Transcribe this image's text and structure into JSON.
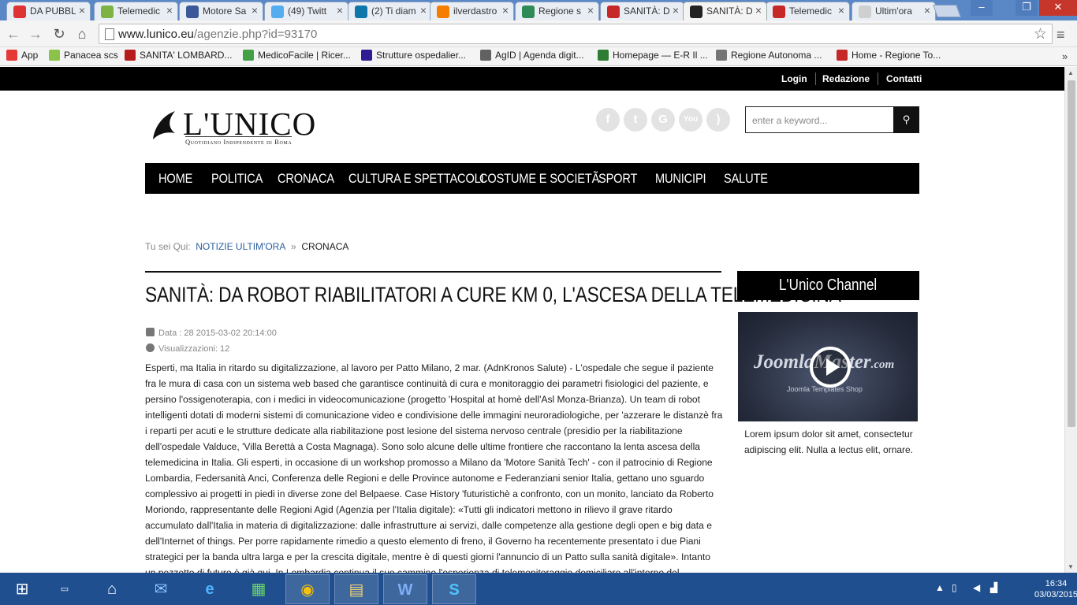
{
  "browser": {
    "tabs": [
      {
        "title": "DA PUBBL",
        "icon": "gmail-icon",
        "color": "#d33"
      },
      {
        "title": "Telemedic",
        "icon": "document-green-icon",
        "color": "#7cb342"
      },
      {
        "title": "Motore Sa",
        "icon": "facebook-icon",
        "color": "#3b5998"
      },
      {
        "title": "(49) Twitt",
        "icon": "twitter-icon",
        "color": "#55acee"
      },
      {
        "title": "(2) Ti diam",
        "icon": "linkedin-icon",
        "color": "#0e76a8"
      },
      {
        "title": "ilverdastro",
        "icon": "blogger-icon",
        "color": "#f57d00"
      },
      {
        "title": "Regione s",
        "icon": "regione-icon",
        "color": "#2e8b57"
      },
      {
        "title": "SANITÀ: D",
        "icon": "x-icon",
        "color": "#c62828"
      },
      {
        "title": "SANITÀ: D",
        "icon": "lunico-icon",
        "color": "#222"
      },
      {
        "title": "Telemedic",
        "icon": "k-icon",
        "color": "#c62828"
      },
      {
        "title": "Ultim'ora",
        "icon": "page-icon",
        "color": "#cfcfcf"
      }
    ],
    "url_host": "www.lunico.eu",
    "url_path": "/agenzie.php?id=93170",
    "bookmarks": [
      {
        "label": "App",
        "color": "#e53935"
      },
      {
        "label": "Panacea scs",
        "color": "#8bc34a"
      },
      {
        "label": "SANITA' LOMBARD...",
        "color": "#b71c1c"
      },
      {
        "label": "MedicoFacile | Ricer...",
        "color": "#43a047"
      },
      {
        "label": "Strutture ospedalier...",
        "color": "#311b92"
      },
      {
        "label": "AgID | Agenda digit...",
        "color": "#616161"
      },
      {
        "label": "Homepage — E-R Il ...",
        "color": "#2e7d32"
      },
      {
        "label": "Regione Autonoma ...",
        "color": "#757575"
      },
      {
        "label": "Home - Regione To...",
        "color": "#c62828"
      }
    ],
    "bookmarks_more": "»"
  },
  "site": {
    "top_links": [
      "Login",
      "Redazione",
      "Contatti"
    ],
    "logo_name": "L'UNICO",
    "logo_tagline": "Quotidiano Indipendente di Roma",
    "social": [
      "facebook-icon",
      "twitter-icon",
      "google-plus-icon",
      "youtube-icon",
      "rss-icon"
    ],
    "search_placeholder": "enter a keyword...",
    "nav": [
      "HOME",
      "POLITICA",
      "CRONACA",
      "CULTURA E SPETTACOLI",
      "COSTUME E SOCIETÃ",
      "SPORT",
      "MUNICIPI",
      "SALUTE"
    ]
  },
  "breadcrumb": {
    "prefix": "Tu sei Qui:",
    "link": "NOTIZIE ULTIM'ORA",
    "sep": "»",
    "current": "CRONACA"
  },
  "article": {
    "title": "SANITÀ: DA ROBOT RIABILITATORI A CURE KM 0, L'ASCESA DELLA TELEMEDICINA",
    "date": "Data : 28 2015-03-02 20:14:00",
    "views": "Visualizzazioni: 12",
    "body": "Esperti, ma Italia in ritardo su digitalizzazione, al lavoro per Patto Milano, 2 mar. (AdnKronos Salute) - L'ospedale che segue il paziente fra le mura di casa con un sistema web based che garantisce continuità di cura e monitoraggio dei parametri fisiologici del paziente, e persino l'ossigenoterapia, con i medici in videocomunicazione (progetto 'Hospital at homè dell'Asl Monza-Brianza). Un team di robot intelligenti dotati di moderni sistemi di comunicazione video e condivisione delle immagini neuroradiologiche, per 'azzerare le distanzè fra i reparti per acuti e le strutture dedicate alla riabilitazione post lesione del sistema nervoso centrale (presidio per la riabilitazione dell'ospedale Valduce, 'Villa Berettà a Costa Magnaga). Sono solo alcune delle ultime frontiere che raccontano la lenta ascesa della telemedicina in Italia. Gli esperti, in occasione di un workshop promosso a Milano da 'Motore Sanità Tech' - con il patrocinio di Regione Lombardia, Federsanità Anci, Conferenza delle Regioni e delle Province autonome e Federanziani senior Italia, gettano uno sguardo complessivo ai progetti in piedi in diverse zone del Belpaese. Case History 'futuristichè a confronto, con un monito, lanciato da Roberto Moriondo, rappresentante delle Regioni Agid (Agenzia per l'Italia digitale): «Tutti gli indicatori mettono in rilievo il grave ritardo accumulato dall'Italia in materia di digitalizzazione: dalle infrastrutture ai servizi, dalle competenze alla gestione degli open e big data e dell'Internet of things. Per porre rapidamente rimedio a questo elemento di freno, il Governo ha recentemente presentato i due Piani strategici per la banda ultra larga e per la crescita digitale, mentre è di questi giorni l'annuncio di un Patto sulla sanità digitale». Intanto un pezzetto di futuro è già qui. In Lombardia continua il suo cammino l'esperienza di telemonitoraggio domiciliare all'interno del"
  },
  "sidebar": {
    "channel_title": "L'Unico Channel",
    "video_brand": "JoomlaMaster",
    "video_brand_suffix": ".com",
    "video_sub": "Joomla Templates Shop",
    "caption": "Lorem ipsum dolor sit amet, consectetur adipiscing elit. Nulla a lectus elit, ornare."
  },
  "taskbar": {
    "apps": [
      "windows-start-icon",
      "lenovo-icon",
      "home-icon",
      "outlook-icon",
      "internet-explorer-icon",
      "store-icon",
      "chrome-icon",
      "file-explorer-icon",
      "word-icon",
      "skype-icon"
    ],
    "time": "16:34",
    "date": "03/03/2015"
  }
}
